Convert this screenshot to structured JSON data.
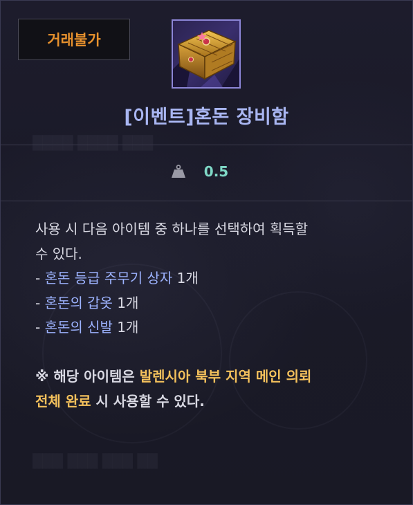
{
  "trade_badge": "거래불가",
  "item": {
    "name": "[이벤트]혼돈 장비함",
    "icon": "golden-treasure-chest-icon",
    "weight_icon": "weight-icon",
    "weight": "0.5"
  },
  "description": {
    "intro_line1": "사용 시 다음 아이템 중 하나를 선택하여 획득할",
    "intro_line2": "수 있다.",
    "options": [
      {
        "prefix": "- ",
        "name": "혼돈 등급 주무기 상자",
        "count": " 1개"
      },
      {
        "prefix": "- ",
        "name": "혼돈의 갑옷",
        "count": " 1개"
      },
      {
        "prefix": "- ",
        "name": "혼돈의 신발",
        "count": " 1개"
      }
    ],
    "notice_prefix": "※ 해당 아이템은 ",
    "notice_highlight_line1": "발렌시아 북부 지역 메인 의뢰",
    "notice_highlight_line2": "전체 완료",
    "notice_suffix": " 시 사용할 수 있다."
  },
  "colors": {
    "trade_badge": "#e8922e",
    "title": "#a9b6f2",
    "weight_value": "#7fd8c6",
    "item_name": "#9db3ff",
    "highlight": "#f4c15c",
    "body_text": "#d8d8e2",
    "icon_frame": "#8d86d8"
  }
}
